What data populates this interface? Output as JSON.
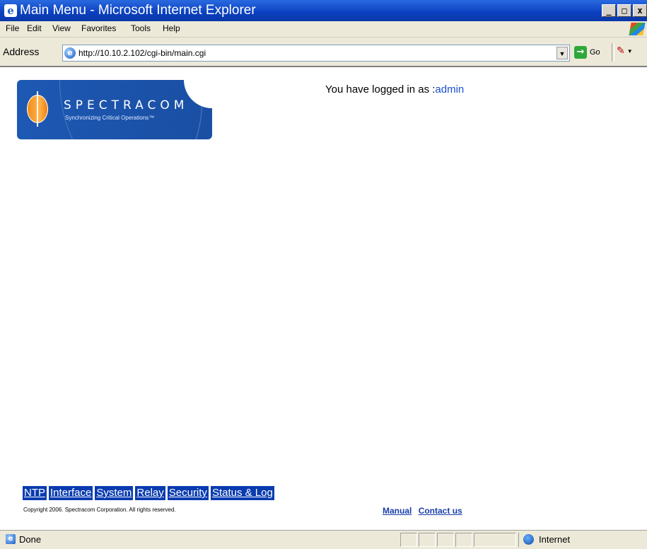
{
  "window": {
    "title": "Main Menu - Microsoft Internet Explorer",
    "icon": "ie-icon",
    "controls": [
      "_",
      "□",
      "x"
    ]
  },
  "menu": {
    "items": [
      "File",
      "Edit",
      "View",
      "Favorites",
      "Tools",
      "Help"
    ]
  },
  "address": {
    "label": "Address",
    "url": "http://10.10.2.102/cgi-bin/main.cgi",
    "go_label": "Go"
  },
  "page": {
    "logo": {
      "brand": "SPECTRACOM",
      "tagline": "Synchronizing Critical Operations™",
      "colors": {
        "primary": "#1a4fa3",
        "accent": "#f08a1a"
      }
    },
    "login_prefix": "You have logged in as :",
    "login_user": "admin",
    "nav": [
      "NTP",
      "Interface",
      "System",
      "Relay",
      "Security",
      "Status & Log"
    ],
    "copyright": "Copyright 2006. Spectracom Corporation. All rights reserved.",
    "footer_links": [
      "Manual",
      "Contact us"
    ]
  },
  "status": {
    "text": "Done",
    "zone": "Internet"
  },
  "colors": {
    "titlebar": "#0a3fbf",
    "nav_bg": "#0a3cb0",
    "link": "#1a3fa8",
    "chrome": "#ece9d8"
  }
}
